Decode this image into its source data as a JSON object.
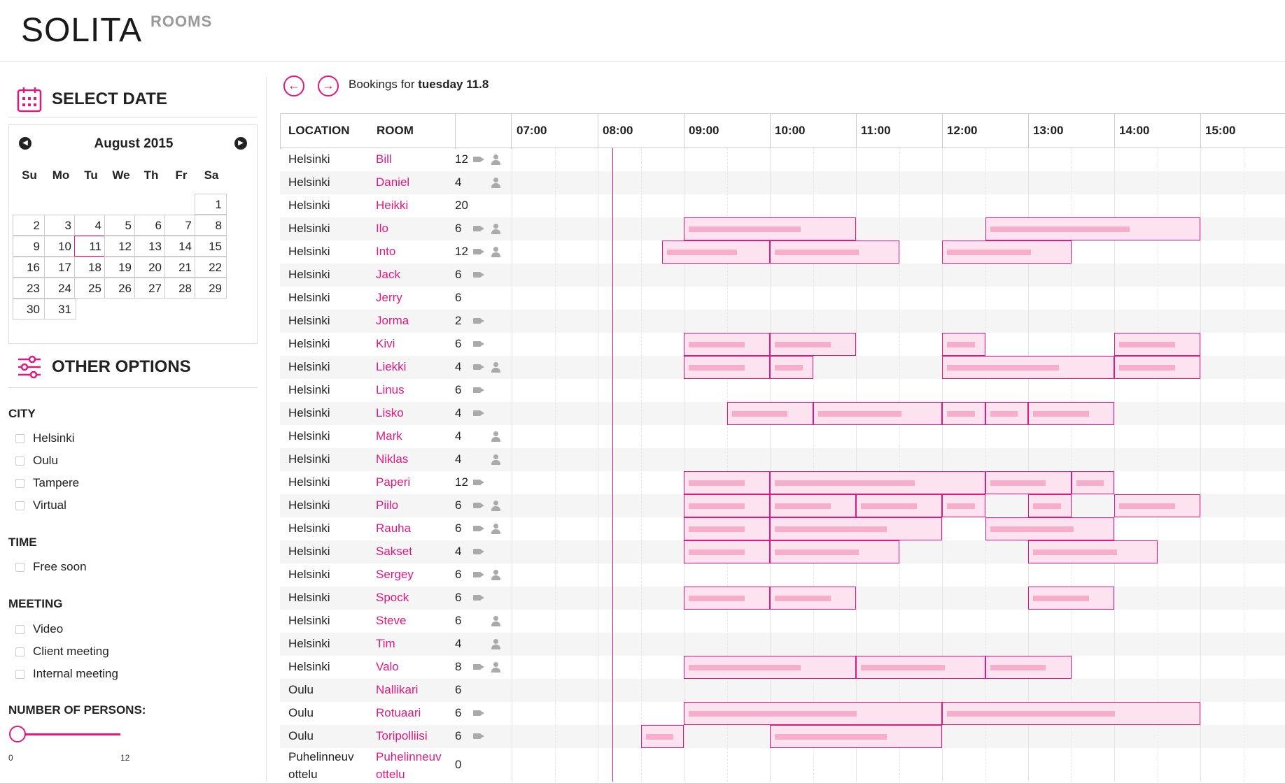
{
  "header": {
    "logo": "SOLITA",
    "subtitle": "ROOMS"
  },
  "sidebar": {
    "select_date_title": "SELECT DATE",
    "calendar": {
      "month_label": "August 2015",
      "prev_icon": "chevron-left-icon",
      "next_icon": "chevron-right-icon",
      "weekdays": [
        "Su",
        "Mo",
        "Tu",
        "We",
        "Th",
        "Fr",
        "Sa"
      ],
      "selected_day": "11",
      "first_weekday_index": 6,
      "days_in_month": 31
    },
    "other_options_title": "OTHER OPTIONS",
    "city": {
      "title": "CITY",
      "options": [
        "Helsinki",
        "Oulu",
        "Tampere",
        "Virtual"
      ]
    },
    "time": {
      "title": "TIME",
      "options": [
        "Free soon"
      ]
    },
    "meeting": {
      "title": "MEETING",
      "options": [
        "Video",
        "Client meeting",
        "Internal meeting"
      ]
    },
    "persons": {
      "title": "NUMBER OF PERSONS:",
      "min_label": "0",
      "max_label": "12",
      "value": 0
    }
  },
  "toolbar": {
    "bookings_prefix": "Bookings for ",
    "bookings_date": "tuesday 11.8"
  },
  "table": {
    "headers": {
      "location": "LOCATION",
      "room": "ROOM"
    },
    "hours": [
      "07:00",
      "08:00",
      "09:00",
      "10:00",
      "11:00",
      "12:00",
      "13:00",
      "14:00",
      "15:00"
    ],
    "now_time": "08:10",
    "rows": [
      {
        "location": "Helsinki",
        "room": "Bill",
        "cap": "12",
        "video": true,
        "client": true
      },
      {
        "location": "Helsinki",
        "room": "Daniel",
        "cap": "4",
        "video": false,
        "client": true
      },
      {
        "location": "Helsinki",
        "room": "Heikki",
        "cap": "20",
        "video": false,
        "client": false
      },
      {
        "location": "Helsinki",
        "room": "Ilo",
        "cap": "6",
        "video": true,
        "client": true,
        "bookings": [
          [
            "09:00",
            "11:00"
          ],
          [
            "12:30",
            "15:00"
          ]
        ]
      },
      {
        "location": "Helsinki",
        "room": "Into",
        "cap": "12",
        "video": true,
        "client": true,
        "bookings": [
          [
            "08:45",
            "10:00"
          ],
          [
            "10:00",
            "11:30"
          ],
          [
            "12:00",
            "13:30"
          ]
        ]
      },
      {
        "location": "Helsinki",
        "room": "Jack",
        "cap": "6",
        "video": true,
        "client": false
      },
      {
        "location": "Helsinki",
        "room": "Jerry",
        "cap": "6",
        "video": false,
        "client": false
      },
      {
        "location": "Helsinki",
        "room": "Jorma",
        "cap": "2",
        "video": true,
        "client": false
      },
      {
        "location": "Helsinki",
        "room": "Kivi",
        "cap": "6",
        "video": true,
        "client": false,
        "bookings": [
          [
            "09:00",
            "10:00"
          ],
          [
            "10:00",
            "11:00"
          ],
          [
            "12:00",
            "12:30"
          ],
          [
            "14:00",
            "15:00"
          ]
        ]
      },
      {
        "location": "Helsinki",
        "room": "Liekki",
        "cap": "4",
        "video": true,
        "client": true,
        "bookings": [
          [
            "09:00",
            "10:00"
          ],
          [
            "10:00",
            "10:30"
          ],
          [
            "12:00",
            "14:00"
          ],
          [
            "14:00",
            "15:00"
          ]
        ]
      },
      {
        "location": "Helsinki",
        "room": "Linus",
        "cap": "6",
        "video": true,
        "client": false
      },
      {
        "location": "Helsinki",
        "room": "Lisko",
        "cap": "4",
        "video": true,
        "client": false,
        "bookings": [
          [
            "09:30",
            "10:30"
          ],
          [
            "10:30",
            "12:00"
          ],
          [
            "12:00",
            "12:30"
          ],
          [
            "12:30",
            "13:00"
          ],
          [
            "13:00",
            "14:00"
          ]
        ]
      },
      {
        "location": "Helsinki",
        "room": "Mark",
        "cap": "4",
        "video": false,
        "client": true
      },
      {
        "location": "Helsinki",
        "room": "Niklas",
        "cap": "4",
        "video": false,
        "client": true
      },
      {
        "location": "Helsinki",
        "room": "Paperi",
        "cap": "12",
        "video": true,
        "client": false,
        "bookings": [
          [
            "09:00",
            "10:00"
          ],
          [
            "10:00",
            "12:30"
          ],
          [
            "12:30",
            "13:30"
          ],
          [
            "13:30",
            "14:00"
          ]
        ]
      },
      {
        "location": "Helsinki",
        "room": "Piilo",
        "cap": "6",
        "video": true,
        "client": true,
        "bookings": [
          [
            "09:00",
            "10:00"
          ],
          [
            "10:00",
            "11:00"
          ],
          [
            "11:00",
            "12:00"
          ],
          [
            "12:00",
            "12:30"
          ],
          [
            "13:00",
            "13:30"
          ],
          [
            "14:00",
            "15:00"
          ]
        ]
      },
      {
        "location": "Helsinki",
        "room": "Rauha",
        "cap": "6",
        "video": true,
        "client": true,
        "bookings": [
          [
            "09:00",
            "10:00"
          ],
          [
            "10:00",
            "12:00"
          ],
          [
            "12:30",
            "14:00"
          ]
        ]
      },
      {
        "location": "Helsinki",
        "room": "Sakset",
        "cap": "4",
        "video": true,
        "client": false,
        "bookings": [
          [
            "09:00",
            "10:00"
          ],
          [
            "10:00",
            "11:30"
          ],
          [
            "13:00",
            "14:30"
          ]
        ]
      },
      {
        "location": "Helsinki",
        "room": "Sergey",
        "cap": "6",
        "video": true,
        "client": true
      },
      {
        "location": "Helsinki",
        "room": "Spock",
        "cap": "6",
        "video": true,
        "client": false,
        "bookings": [
          [
            "09:00",
            "10:00"
          ],
          [
            "10:00",
            "11:00"
          ],
          [
            "13:00",
            "14:00"
          ]
        ]
      },
      {
        "location": "Helsinki",
        "room": "Steve",
        "cap": "6",
        "video": false,
        "client": true
      },
      {
        "location": "Helsinki",
        "room": "Tim",
        "cap": "4",
        "video": false,
        "client": true
      },
      {
        "location": "Helsinki",
        "room": "Valo",
        "cap": "8",
        "video": true,
        "client": true,
        "bookings": [
          [
            "09:00",
            "11:00"
          ],
          [
            "11:00",
            "12:30"
          ],
          [
            "12:30",
            "13:30"
          ]
        ]
      },
      {
        "location": "Oulu",
        "room": "Nallikari",
        "cap": "6",
        "video": false,
        "client": false
      },
      {
        "location": "Oulu",
        "room": "Rotuaari",
        "cap": "6",
        "video": true,
        "client": false,
        "bookings": [
          [
            "09:00",
            "12:00"
          ],
          [
            "12:00",
            "15:00"
          ]
        ]
      },
      {
        "location": "Oulu",
        "room": "Toripolliisi",
        "cap": "6",
        "video": true,
        "client": false,
        "bookings": [
          [
            "08:30",
            "09:00"
          ],
          [
            "10:00",
            "12:00"
          ]
        ]
      },
      {
        "location": "Puhelinneuv ottelu",
        "room": "Puhelinneuv ottelu",
        "cap": "0",
        "video": false,
        "client": false
      }
    ]
  },
  "colors": {
    "accent": "#e0197d",
    "booking_fill": "#fde3ef",
    "row_alt": "#f5f5f5"
  }
}
